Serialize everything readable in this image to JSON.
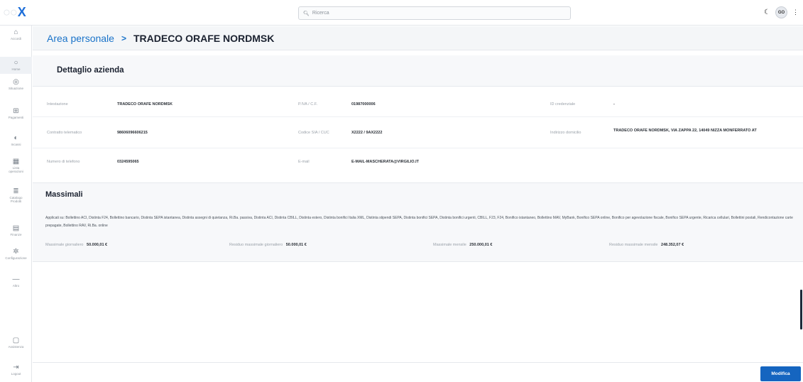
{
  "app": {
    "logo_faded": "○○",
    "logo_mark": "X",
    "search_placeholder": "Ricerca",
    "avatar_initials": "GO"
  },
  "sidebar": {
    "items": [
      {
        "icon": "home",
        "label": "Accordi",
        "glyph": "⌂"
      },
      {
        "icon": "circle",
        "label": "Home",
        "glyph": "○"
      },
      {
        "icon": "globe",
        "label": "Situazione",
        "glyph": "◎"
      },
      {
        "icon": "payments",
        "label": "Pagamenti",
        "glyph": "⊞"
      },
      {
        "icon": "file",
        "label": "Incassi",
        "glyph": "◐"
      },
      {
        "icon": "grid",
        "label": "Lista operazioni",
        "glyph": "▦"
      },
      {
        "icon": "stack",
        "label": "Catalogo Prodotti",
        "glyph": "≣"
      },
      {
        "icon": "calendar",
        "label": "Finanze",
        "glyph": "▤"
      },
      {
        "icon": "gear",
        "label": "Configurazione",
        "glyph": "✲"
      },
      {
        "icon": "minus",
        "label": "Altro",
        "glyph": "—"
      },
      {
        "icon": "chat",
        "label": "Assistenza",
        "glyph": "▢"
      },
      {
        "icon": "logout",
        "label": "Logout",
        "glyph": "⇥"
      }
    ]
  },
  "breadcrumb": {
    "parent": "Area personale",
    "separator": ">",
    "current": "TRADECO ORAFE NORDMSK"
  },
  "detail": {
    "title": "Dettaglio azienda",
    "fields": [
      {
        "label": "Intestazione",
        "value": "TRADECO ORAFE NORDMSK"
      },
      {
        "label": "P.IVA / C.F.",
        "value": "01987000006"
      },
      {
        "label": "ID credenziale",
        "value": "-"
      },
      {
        "label": "Contratto telematico",
        "value": "98606096606215"
      },
      {
        "label": "Codice SIA / CUC",
        "value": "X2222 / 9AX2222"
      },
      {
        "label": "Indirizzo domicilio",
        "value": "TRADECO ORAFE NORDMSK, VIA ZAPPA 22, 14049 NIZZA MONFERRATO AT"
      },
      {
        "label": "Numero di telefono",
        "value": "0324595065"
      },
      {
        "label": "E-mail",
        "value": "E-MAIL-MASCHERATA@VIRGILIO.IT"
      }
    ]
  },
  "massimali": {
    "title": "Massimali",
    "description": "Applicati su: Bollettino ACI, Distinta F24, Bollettino bancario, Distinta SEPA istantanea, Distinta assegni di quietanza, Ri.Ba. passiva, Distinta ACI, Distinta CBILL, Distinta estero, Distinta bonifici Italia XML, Distinta stipendi SEPA, Distinta bonifici SEPA, Distinta bonifici urgenti, CBILL, F23, F24, Bonifico istantaneo, Bollettino MAV, MyBank, Bonifico SEPA online, Bonifico per agevolazione fiscale, Bonifico SEPA urgente, Ricarica cellulari, Bollettini postali, Rendicontazione carte prepagate, Bollettino RAV, Ri.Ba. online",
    "items": [
      {
        "label": "Massimale giornaliero",
        "value": "50.000,01 €"
      },
      {
        "label": "Residuo massimale giornaliero",
        "value": "50.000,01 €"
      },
      {
        "label": "Massimale mensile",
        "value": "250.000,01 €"
      },
      {
        "label": "Residuo massimale mensile",
        "value": "248.352,07 €"
      }
    ]
  },
  "footer": {
    "edit_button": "Modifica"
  },
  "colors": {
    "accent": "#1565c0",
    "link": "#1a73c9"
  }
}
